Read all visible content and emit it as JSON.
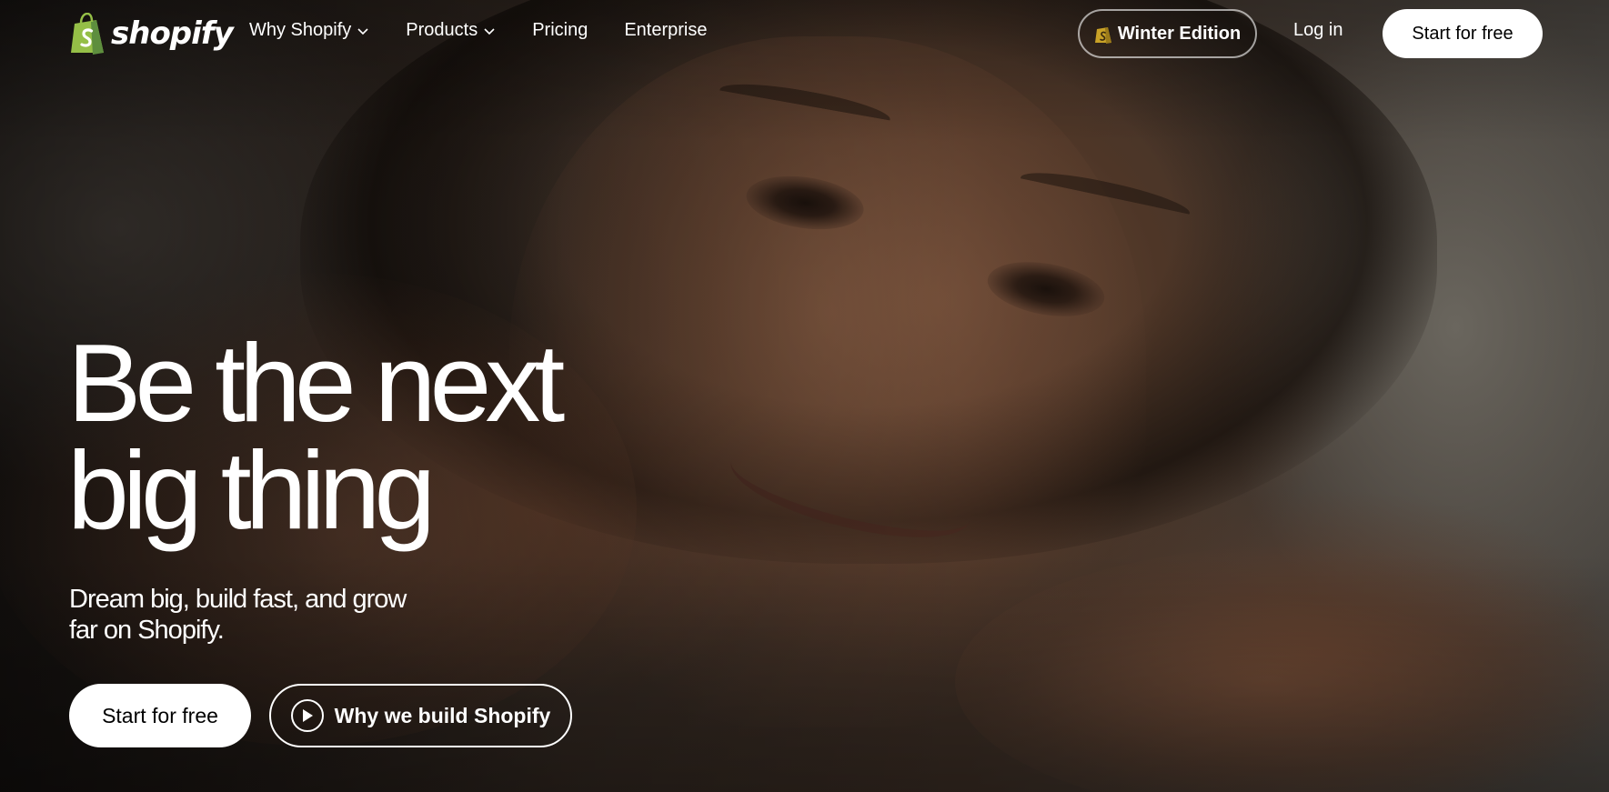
{
  "brand": {
    "name": "shopify",
    "logo_color": "#95bf47"
  },
  "nav": {
    "items": [
      {
        "label": "Why Shopify",
        "has_dropdown": true
      },
      {
        "label": "Products",
        "has_dropdown": true
      },
      {
        "label": "Pricing",
        "has_dropdown": false
      },
      {
        "label": "Enterprise",
        "has_dropdown": false
      }
    ],
    "winter_edition": "Winter Edition",
    "login": "Log in",
    "start_free": "Start for free"
  },
  "hero": {
    "headline_line1": "Be the next",
    "headline_line2": "big thing",
    "subtitle_line1": "Dream big, build fast, and grow",
    "subtitle_line2": "far on Shopify.",
    "cta_primary": "Start for free",
    "cta_secondary": "Why we build Shopify"
  },
  "colors": {
    "text": "#ffffff",
    "button_bg": "#ffffff",
    "button_text": "#000000"
  }
}
